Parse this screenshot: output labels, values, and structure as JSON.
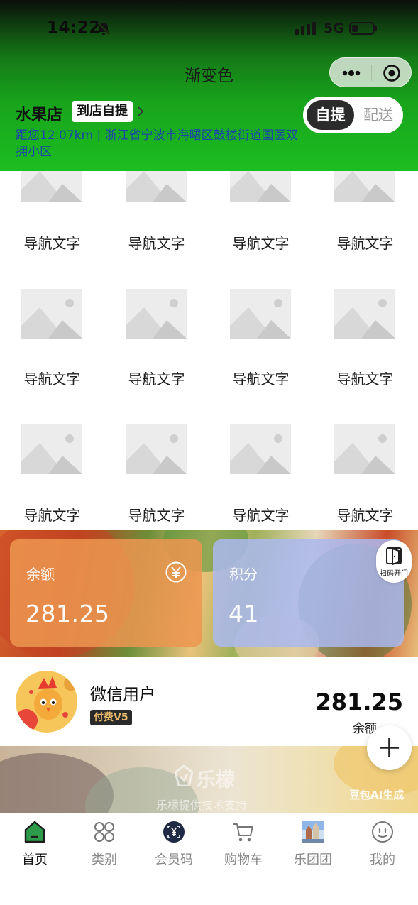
{
  "status_bar": {
    "time": "14:22",
    "network": "5G"
  },
  "navbar": {
    "title": "渐变色"
  },
  "store": {
    "name": "水果店",
    "pickup_badge": "到店自提",
    "address": "距您12.07km | 浙江省宁波市海曙区鼓楼街道国医双拥小区",
    "mode_options": [
      "自提",
      "配送"
    ],
    "active_mode": "自提"
  },
  "nav_grid": {
    "items": [
      {
        "label": "导航文字"
      },
      {
        "label": "导航文字"
      },
      {
        "label": "导航文字"
      },
      {
        "label": "导航文字"
      },
      {
        "label": "导航文字"
      },
      {
        "label": "导航文字"
      },
      {
        "label": "导航文字"
      },
      {
        "label": "导航文字"
      },
      {
        "label": "导航文字"
      },
      {
        "label": "导航文字"
      },
      {
        "label": "导航文字"
      },
      {
        "label": "导航文字"
      }
    ]
  },
  "cards": {
    "balance": {
      "title": "余额",
      "value": "281.25",
      "icon": "yen-icon"
    },
    "points": {
      "title": "积分",
      "value": "41"
    },
    "scan_button": "扫码开门"
  },
  "user": {
    "name": "微信用户",
    "badge": "付费V5",
    "balance": "281.25",
    "balance_label": "余额"
  },
  "footer_banner": {
    "brand": "乐檬",
    "subtitle": "乐檬提供技术支持",
    "ai_label": "豆包AI生成"
  },
  "tabbar": {
    "tabs": [
      {
        "label": "首页",
        "icon": "home-icon"
      },
      {
        "label": "类别",
        "icon": "category-icon"
      },
      {
        "label": "会员码",
        "icon": "member-code-icon"
      },
      {
        "label": "购物车",
        "icon": "cart-icon"
      },
      {
        "label": "乐团团",
        "icon": "group-icon"
      },
      {
        "label": "我的",
        "icon": "profile-icon"
      }
    ],
    "active_index": 0
  },
  "colors": {
    "header_gradient_top": "#0b0f0b",
    "header_gradient_bottom": "#1cbe20",
    "address_link": "#1b46a8",
    "balance_card": "#ec9650",
    "points_card": "#aab9f0",
    "active_tab": "#2e9b4a"
  }
}
